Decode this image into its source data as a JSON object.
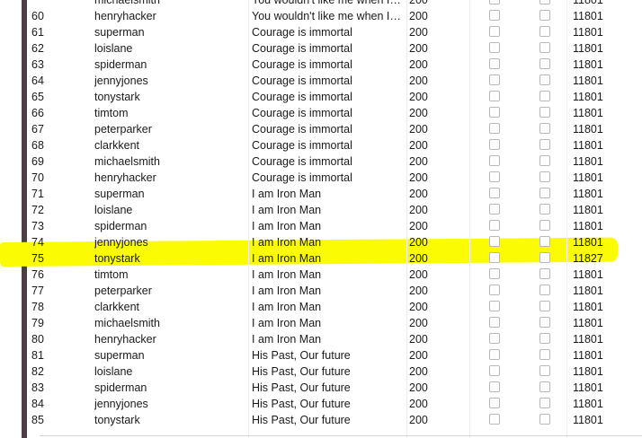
{
  "rows": [
    {
      "id": "60",
      "user": "henryhacker",
      "message": "You wouldn't like me when I'm angry",
      "code": "200",
      "count": "11801"
    },
    {
      "id": "61",
      "user": "superman",
      "message": "Courage is immortal",
      "code": "200",
      "count": "11801"
    },
    {
      "id": "62",
      "user": "loislane",
      "message": "Courage is immortal",
      "code": "200",
      "count": "11801"
    },
    {
      "id": "63",
      "user": "spiderman",
      "message": "Courage is immortal",
      "code": "200",
      "count": "11801"
    },
    {
      "id": "64",
      "user": "jennyjones",
      "message": "Courage is immortal",
      "code": "200",
      "count": "11801"
    },
    {
      "id": "65",
      "user": "tonystark",
      "message": "Courage is immortal",
      "code": "200",
      "count": "11801"
    },
    {
      "id": "66",
      "user": "timtom",
      "message": "Courage is immortal",
      "code": "200",
      "count": "11801"
    },
    {
      "id": "67",
      "user": "peterparker",
      "message": "Courage is immortal",
      "code": "200",
      "count": "11801"
    },
    {
      "id": "68",
      "user": "clarkkent",
      "message": "Courage is immortal",
      "code": "200",
      "count": "11801"
    },
    {
      "id": "69",
      "user": "michaelsmith",
      "message": "Courage is immortal",
      "code": "200",
      "count": "11801"
    },
    {
      "id": "70",
      "user": "henryhacker",
      "message": "Courage is immortal",
      "code": "200",
      "count": "11801"
    },
    {
      "id": "71",
      "user": "superman",
      "message": "I am Iron Man",
      "code": "200",
      "count": "11801"
    },
    {
      "id": "72",
      "user": "loislane",
      "message": "I am Iron Man",
      "code": "200",
      "count": "11801"
    },
    {
      "id": "73",
      "user": "spiderman",
      "message": "I am Iron Man",
      "code": "200",
      "count": "11801"
    },
    {
      "id": "74",
      "user": "jennyjones",
      "message": "I am Iron Man",
      "code": "200",
      "count": "11801"
    },
    {
      "id": "75",
      "user": "tonystark",
      "message": "I am Iron Man",
      "code": "200",
      "count": "11827"
    },
    {
      "id": "76",
      "user": "timtom",
      "message": "I am Iron Man",
      "code": "200",
      "count": "11801"
    },
    {
      "id": "77",
      "user": "peterparker",
      "message": "I am Iron Man",
      "code": "200",
      "count": "11801"
    },
    {
      "id": "78",
      "user": "clarkkent",
      "message": "I am Iron Man",
      "code": "200",
      "count": "11801"
    },
    {
      "id": "79",
      "user": "michaelsmith",
      "message": "I am Iron Man",
      "code": "200",
      "count": "11801"
    },
    {
      "id": "80",
      "user": "henryhacker",
      "message": "I am Iron Man",
      "code": "200",
      "count": "11801"
    },
    {
      "id": "81",
      "user": "superman",
      "message": "His Past, Our future",
      "code": "200",
      "count": "11801"
    },
    {
      "id": "82",
      "user": "loislane",
      "message": "His Past, Our future",
      "code": "200",
      "count": "11801"
    },
    {
      "id": "83",
      "user": "spiderman",
      "message": "His Past, Our future",
      "code": "200",
      "count": "11801"
    },
    {
      "id": "84",
      "user": "jennyjones",
      "message": "His Past, Our future",
      "code": "200",
      "count": "11801"
    },
    {
      "id": "85",
      "user": "tonystark",
      "message": "His Past, Our future",
      "code": "200",
      "count": "11801"
    }
  ],
  "top_partial": {
    "user": "michaelsmith",
    "message": "You wouldn't like me when I'm angry",
    "code": "200",
    "count": "11801"
  },
  "highlight_color": "#fbfb04",
  "highlighted_row_id": "75"
}
